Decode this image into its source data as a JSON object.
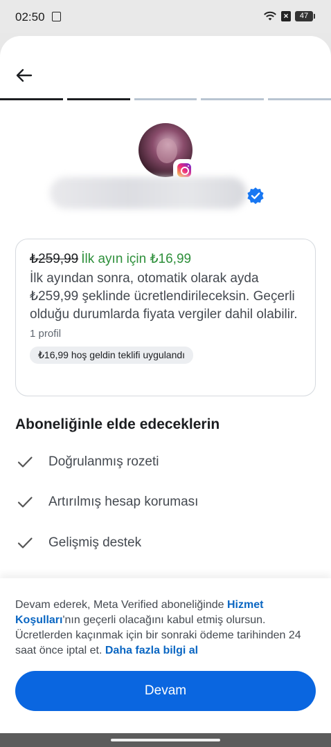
{
  "status_bar": {
    "time": "02:50",
    "battery": "47"
  },
  "header": {
    "back_icon": "arrow-left-icon",
    "progress_steps": 5,
    "progress_completed": 2
  },
  "profile": {
    "platform_icon": "instagram-icon",
    "verified_icon": "verified-badge-icon"
  },
  "offer": {
    "old_price": "₺259,99",
    "promo_text": "İlk ayın için ₺16,99",
    "description": "İlk ayından sonra, otomatik olarak ayda ₺259,99 şeklinde ücretlendirileceksin. Geçerli olduğu durumlarda fiyata vergiler dahil olabilir.",
    "profile_count": "1 profil",
    "welcome_chip": "₺16,99 hoş geldin teklifi uygulandı"
  },
  "benefits": {
    "title": "Aboneliğinle elde edeceklerin",
    "items": [
      {
        "label": "Doğrulanmış rozeti",
        "icon": "check-icon"
      },
      {
        "label": "Artırılmış hesap koruması",
        "icon": "check-icon"
      },
      {
        "label": "Gelişmiş destek",
        "icon": "check-icon"
      }
    ]
  },
  "footer": {
    "terms_part1": "Devam ederek, Meta Verified aboneliğinde ",
    "terms_link1": "Hizmet Koşulları",
    "terms_part2": "'nın geçerli olacağını kabul etmiş olursun. Ücretlerden kaçınmak için bir sonraki ödeme tarihinden 24 saat önce iptal et. ",
    "terms_link2": "Daha fazla bilgi al",
    "continue_label": "Devam"
  },
  "colors": {
    "accent": "#0a66e0",
    "promo_green": "#2d8f3a",
    "link": "#0a66c2"
  }
}
